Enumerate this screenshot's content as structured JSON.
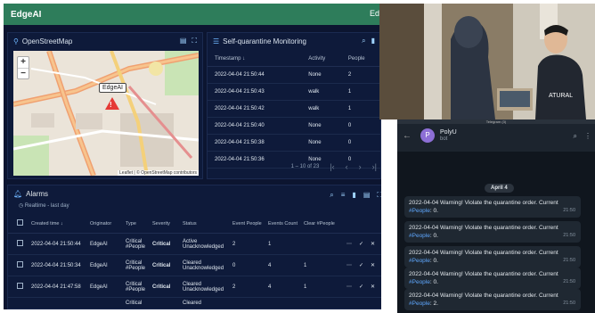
{
  "app": {
    "title": "EdgeAI",
    "title_right": "Ed"
  },
  "map_panel": {
    "title": "OpenStreetMap",
    "zoom_in": "+",
    "zoom_out": "−",
    "marker_label": "EdgeAI",
    "attribution": "Leaflet | © OpenStreetMap contributors"
  },
  "monitor_panel": {
    "title": "Self-quarantine Monitoring",
    "columns": [
      "Timestamp ↓",
      "Activity",
      "People"
    ],
    "rows": [
      [
        "2022-04-04 21:50:44",
        "None",
        "2"
      ],
      [
        "2022-04-04 21:50:43",
        "walk",
        "1"
      ],
      [
        "2022-04-04 21:50:42",
        "walk",
        "1"
      ],
      [
        "2022-04-04 21:50:40",
        "None",
        "0"
      ],
      [
        "2022-04-04 21:50:38",
        "None",
        "0"
      ],
      [
        "2022-04-04 21:50:36",
        "None",
        "0"
      ]
    ],
    "pagination": "1 – 10 of 23"
  },
  "alarm_panel": {
    "title": "Alarms",
    "subtitle": "Realtime - last day",
    "columns": [
      "Created time ↓",
      "Originator",
      "Type",
      "Severity",
      "Status",
      "Event People",
      "Events Count",
      "Clear #People"
    ],
    "rows": [
      {
        "time": "2022-04-04 21:50:44",
        "originator": "EdgeAI",
        "type": "Critical #People",
        "severity": "Critical",
        "status": "Active Unacknowledged",
        "event_people": "2",
        "events_count": "1",
        "clear_people": ""
      },
      {
        "time": "2022-04-04 21:50:34",
        "originator": "EdgeAI",
        "type": "Critical #People",
        "severity": "Critical",
        "status": "Cleared Unacknowledged",
        "event_people": "0",
        "events_count": "4",
        "clear_people": "1"
      },
      {
        "time": "2022-04-04 21:47:58",
        "originator": "EdgeAI",
        "type": "Critical #People",
        "severity": "Critical",
        "status": "Cleared Unacknowledged",
        "event_people": "2",
        "events_count": "4",
        "clear_people": "1"
      }
    ],
    "partial_row": {
      "type": "Critical",
      "status": "Cleared"
    }
  },
  "chat": {
    "window_title": "Telegram (3)",
    "avatar_letter": "P",
    "name": "PolyU",
    "status": "bot",
    "date": "April 4",
    "messages": [
      {
        "text": "2022-04-04 Warning! Violate the quarantine order. Current ",
        "tag": "#People",
        "count": ": 0.",
        "time": "21:50"
      },
      {
        "text": "2022-04-04 Warning! Violate the quarantine order. Current ",
        "tag": "#People",
        "count": ": 0.",
        "time": "21:50"
      },
      {
        "text": "2022-04-04 Warning! Violate the quarantine order. Current ",
        "tag": "#People",
        "count": ": 0.",
        "time": "21:50"
      },
      {
        "text": "2022-04-04 Warning! Violate the quarantine order. Current ",
        "tag": "#People",
        "count": ": 0.",
        "time": "21:50"
      },
      {
        "text": "2022-04-04 Warning! Violate the quarantine order. Current ",
        "tag": "#People",
        "count": ": 2.",
        "time": "21:50"
      }
    ]
  },
  "icons": {
    "map_pin": "map-pin-icon",
    "list": "list-icon",
    "bell": "bell-icon",
    "search": "search-icon"
  },
  "colors": {
    "topbar": "#2e7d5b",
    "panel_bg": "#0e1a3a",
    "critical": "#ff5a4f",
    "chat_bg": "#10161e",
    "hashtag": "#5fa8ff"
  }
}
